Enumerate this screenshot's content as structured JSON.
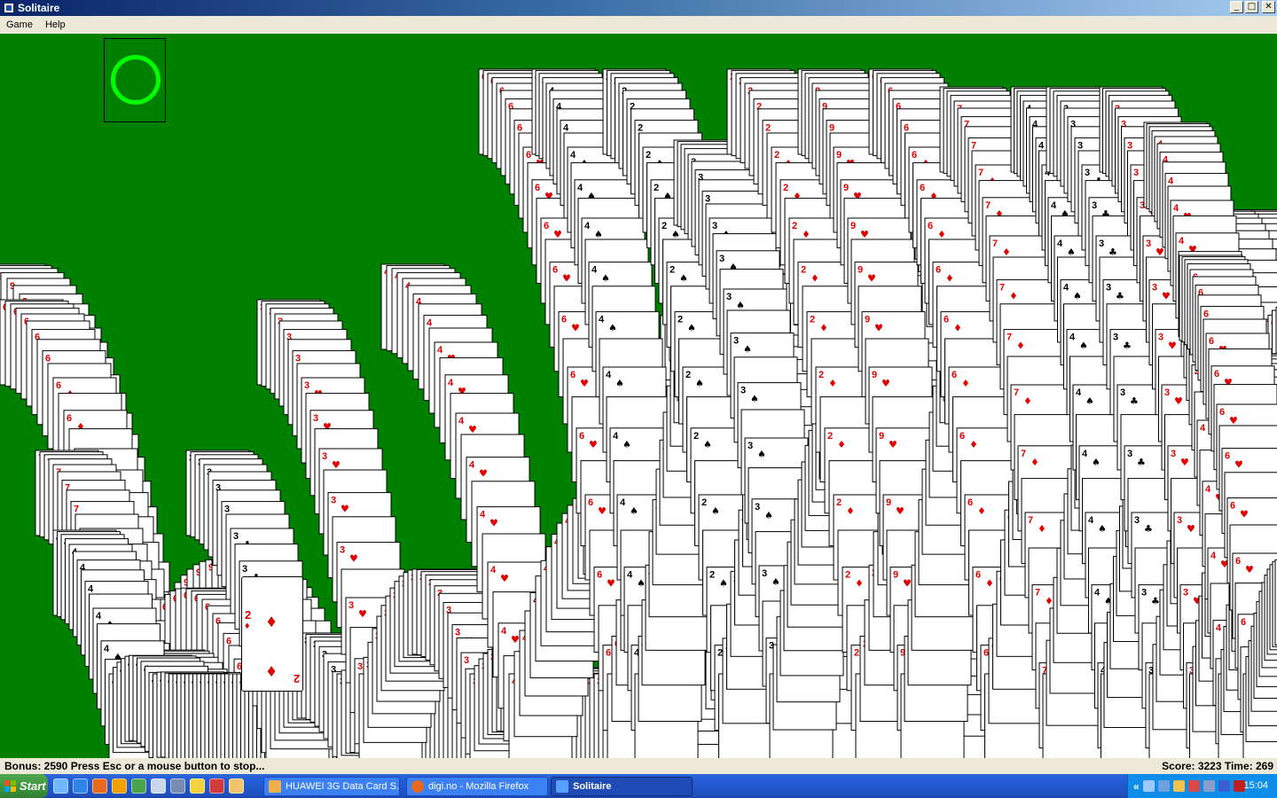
{
  "window": {
    "title": "Solitaire"
  },
  "menu": {
    "items": [
      "Game",
      "Help"
    ]
  },
  "window_controls": {
    "minimize": "_",
    "maximize": "□",
    "close": "✕"
  },
  "status": {
    "left": "Bonus: 2590  Press Esc or a mouse button to stop...",
    "right": "Score: 3223 Time: 269"
  },
  "game": {
    "felt_color": "#008000",
    "stock_marker_color": "#00ff00",
    "card": {
      "value": "2",
      "suit": "♦",
      "suit_name": "diamonds",
      "color": "#e00000"
    },
    "trail_labels": [
      {
        "value": "9",
        "suit": "♥",
        "color": "red"
      },
      {
        "value": "6",
        "suit": "♦",
        "color": "red"
      },
      {
        "value": "7",
        "suit": "♦",
        "color": "red"
      },
      {
        "value": "4",
        "suit": "♠",
        "color": "black"
      },
      {
        "value": "3",
        "suit": "♣",
        "color": "black"
      },
      {
        "value": "3",
        "suit": "♥",
        "color": "red"
      },
      {
        "value": "4",
        "suit": "♥",
        "color": "red"
      },
      {
        "value": "6",
        "suit": "♥",
        "color": "red"
      },
      {
        "value": "4",
        "suit": "♠",
        "color": "black"
      },
      {
        "value": "2",
        "suit": "♠",
        "color": "black"
      },
      {
        "value": "3",
        "suit": "♠",
        "color": "black"
      },
      {
        "value": "2",
        "suit": "♦",
        "color": "red"
      }
    ]
  },
  "taskbar": {
    "start_label": "Start",
    "quick_launch": [
      "ie-icon",
      "firefox-icon",
      "media-icon",
      "messenger-icon",
      "computer-icon",
      "people-icon",
      "winamp-icon",
      "app-icon",
      "mail-icon"
    ],
    "tasks": [
      {
        "label": "HUAWEI 3G Data Card S...",
        "icon": "modem-icon",
        "active": false
      },
      {
        "label": "digi.no - Mozilla Firefox",
        "icon": "firefox-icon",
        "active": false
      },
      {
        "label": "Solitaire",
        "icon": "solitaire-icon",
        "active": true
      }
    ],
    "tray_chevron": "«",
    "clock": "15:04"
  }
}
